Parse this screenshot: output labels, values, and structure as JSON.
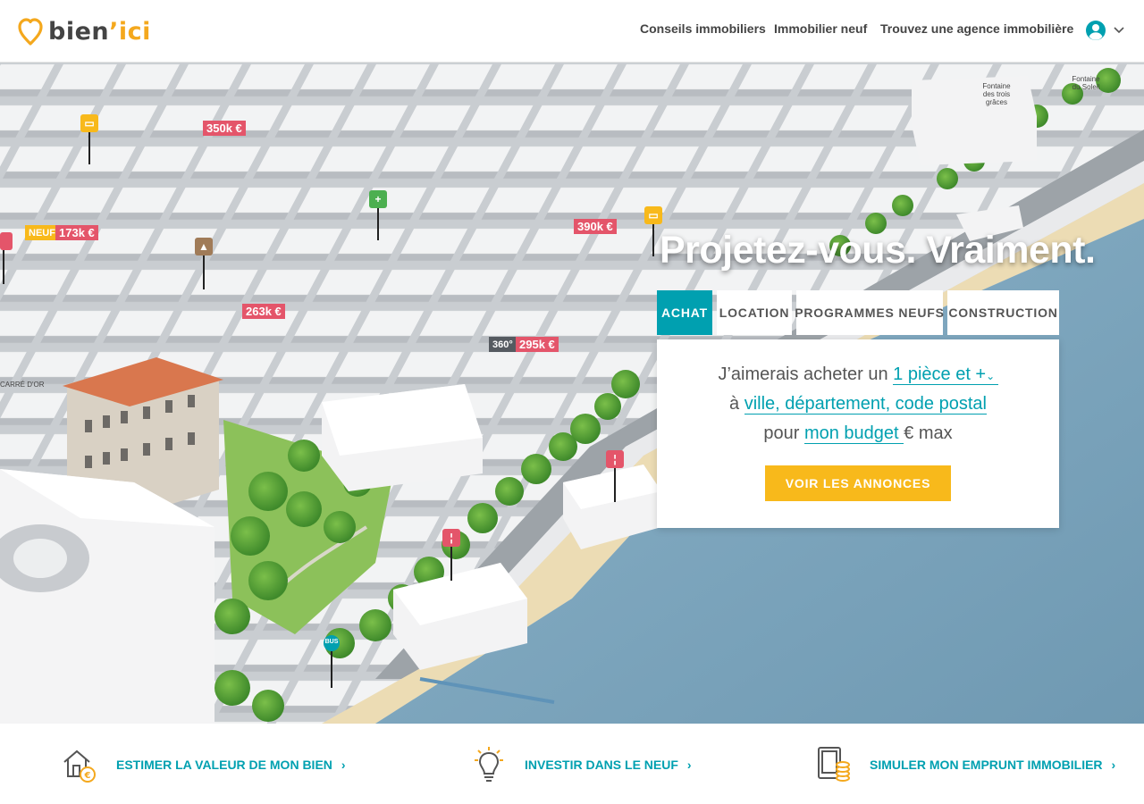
{
  "header": {
    "logo": {
      "part1": "bien",
      "apostrophe": "’",
      "part2": "ici"
    },
    "nav": [
      "Conseils immobiliers",
      "Immobilier neuf",
      "Trouvez une agence immobilière"
    ],
    "user_icon": "user-circle-icon"
  },
  "hero": {
    "tagline": "Projetez-vous. Vraiment.",
    "tabs": [
      {
        "label": "ACHAT",
        "active": true
      },
      {
        "label": "LOCATION",
        "active": false
      },
      {
        "label": "PROGRAMMES NEUFS",
        "active": false
      },
      {
        "label": "CONSTRUCTION",
        "active": false
      }
    ],
    "search": {
      "line1_prefix": "J’aimerais acheter un ",
      "rooms": "1 pièce et +",
      "line2_prefix": "à ",
      "location": "ville, département, code postal",
      "line3_prefix": "pour ",
      "budget": "mon budget ",
      "line3_suffix": "€ max",
      "cta": "VOIR LES ANNONCES"
    },
    "map": {
      "prices": [
        "350k €",
        "173k €",
        "390k €",
        "263k €",
        "295k €"
      ],
      "new_badge": "NEUF",
      "view_badge": "360°",
      "labels": [
        "Fontaine des trois grâces",
        "Fontaine du Soleil",
        "CARRÉ D'OR",
        "BUS"
      ]
    }
  },
  "bottom": {
    "items": [
      {
        "label": "ESTIMER LA VALEUR DE MON BIEN",
        "icon": "house-euro-icon"
      },
      {
        "label": "INVESTIR DANS LE NEUF",
        "icon": "lightbulb-icon"
      },
      {
        "label": "SIMULER MON EMPRUNT IMMOBILIER",
        "icon": "calculator-coins-icon"
      }
    ]
  },
  "colors": {
    "accent": "#00a0b0",
    "cta": "#f8b91b",
    "price_tag": "#e4556a",
    "sea": "#7fa6bd",
    "sand": "#ecdcb4"
  }
}
